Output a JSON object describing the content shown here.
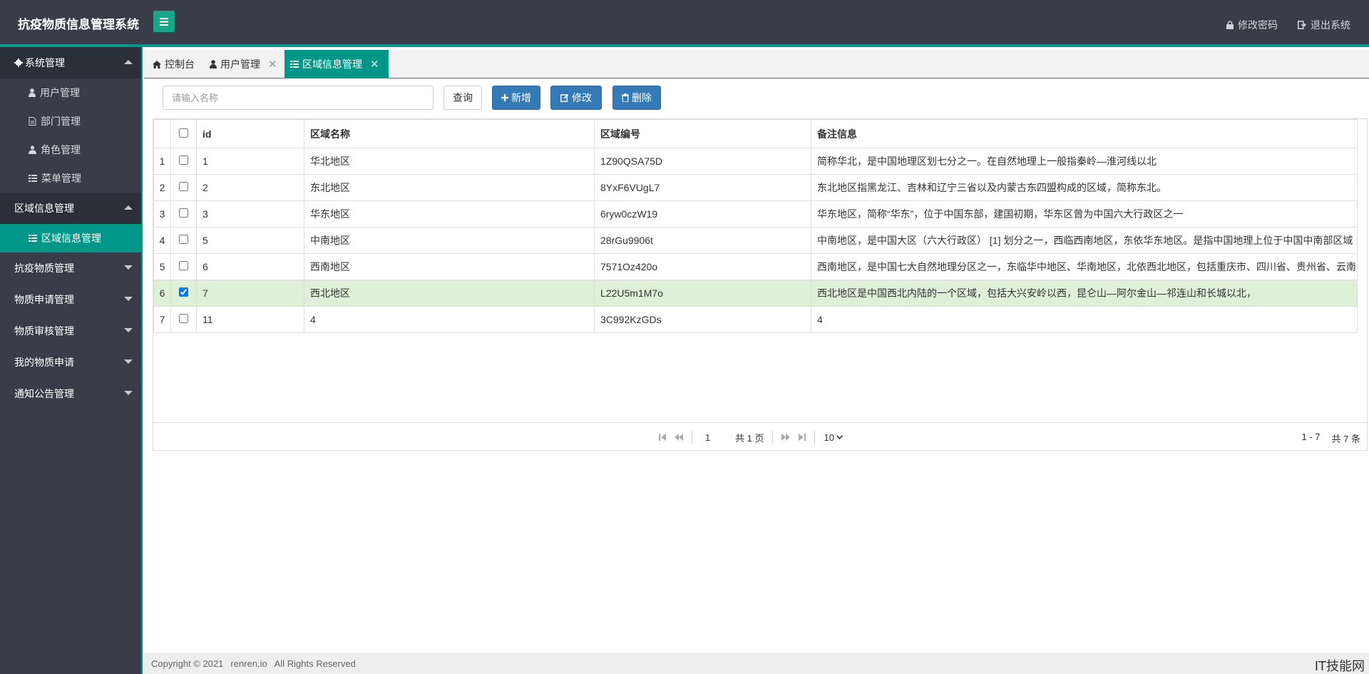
{
  "header": {
    "title": "抗疫物质信息管理系统",
    "change_password": "修改密码",
    "logout": "退出系统"
  },
  "sidebar": {
    "groups": [
      {
        "label": "系统管理",
        "expanded": true,
        "items": [
          {
            "label": "用户管理",
            "icon": "user-icon"
          },
          {
            "label": "部门管理",
            "icon": "file-icon"
          },
          {
            "label": "角色管理",
            "icon": "role-icon"
          },
          {
            "label": "菜单管理",
            "icon": "list-icon"
          }
        ]
      },
      {
        "label": "区域信息管理",
        "expanded": true,
        "items": [
          {
            "label": "区域信息管理",
            "icon": "list-icon",
            "active": true
          }
        ]
      },
      {
        "label": "抗疫物质管理",
        "expanded": false
      },
      {
        "label": "物质申请管理",
        "expanded": false
      },
      {
        "label": "物质审核管理",
        "expanded": false
      },
      {
        "label": "我的物质申请",
        "expanded": false
      },
      {
        "label": "通知公告管理",
        "expanded": false
      }
    ]
  },
  "tabs": [
    {
      "label": "控制台",
      "icon": "home-icon"
    },
    {
      "label": "用户管理",
      "icon": "user-icon"
    },
    {
      "label": "区域信息管理",
      "icon": "list-icon",
      "active": true
    }
  ],
  "toolbar": {
    "search_placeholder": "请输入名称",
    "query_label": "查询",
    "add_label": "新增",
    "edit_label": "修改",
    "delete_label": "删除"
  },
  "table": {
    "columns": [
      "id",
      "区域名称",
      "区域编号",
      "备注信息"
    ],
    "rows": [
      {
        "no": "1",
        "id": "1",
        "name": "华北地区",
        "code": "1Z90QSA75D",
        "remark": "简称华北，是中国地理区划七分之一。在自然地理上一般指秦岭—淮河线以北",
        "checked": false
      },
      {
        "no": "2",
        "id": "2",
        "name": "东北地区",
        "code": "8YxF6VUgL7",
        "remark": "东北地区指黑龙江、吉林和辽宁三省以及内蒙古东四盟构成的区域，简称东北。",
        "checked": false
      },
      {
        "no": "3",
        "id": "3",
        "name": "华东地区",
        "code": "6ryw0czW19",
        "remark": "华东地区，简称“华东”，位于中国东部，建国初期，华东区曾为中国六大行政区之一",
        "checked": false
      },
      {
        "no": "4",
        "id": "5",
        "name": "中南地区",
        "code": "28rGu9906t",
        "remark": "中南地区，是中国大区（六大行政区） [1]  划分之一，西临西南地区，东依华东地区。是指中国地理上位于中国中南部区域",
        "checked": false
      },
      {
        "no": "5",
        "id": "6",
        "name": "西南地区",
        "code": "7571Oz420o",
        "remark": "西南地区，是中国七大自然地理分区之一，东临华中地区、华南地区，北依西北地区，包括重庆市、四川省、贵州省、云南",
        "checked": false
      },
      {
        "no": "6",
        "id": "7",
        "name": "西北地区",
        "code": "L22U5m1M7o",
        "remark": "西北地区是中国西北内陆的一个区域，包括大兴安岭以西，昆仑山—阿尔金山—祁连山和长城以北，",
        "checked": true
      },
      {
        "no": "7",
        "id": "11",
        "name": "4",
        "code": "3C992KzGDs",
        "remark": "4",
        "checked": false
      }
    ]
  },
  "pager": {
    "page": "1",
    "total_pages": "共 1 页",
    "page_size": "10",
    "range": "1 - 7",
    "total": "共 7 条"
  },
  "footer": {
    "copyright": "Copyright © 2021",
    "site": "renren.io",
    "rights": "All Rights Reserved"
  },
  "watermark": "IT技能网",
  "colors": {
    "header_bg": "#393d49",
    "accent": "#009688",
    "primary_button": "#337ab7",
    "selected_row": "#dff0d8"
  }
}
